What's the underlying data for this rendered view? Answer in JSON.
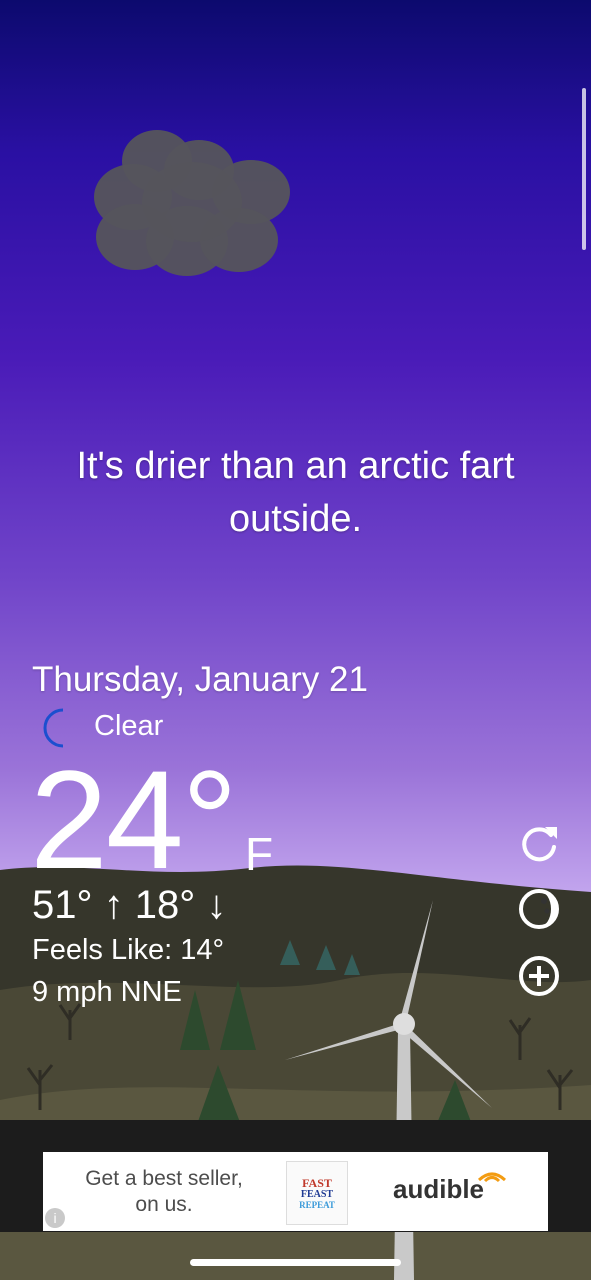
{
  "quote": "It's drier than an arctic fart outside.",
  "weather": {
    "date": "Thursday, January 21",
    "condition_icon": "moon-icon",
    "condition": "Clear",
    "temperature": "24°",
    "unit": "F",
    "hi_lo": "51° ↑  18° ↓",
    "feels_like": "Feels Like: 14°",
    "wind": "9 mph NNE"
  },
  "controls": {
    "refresh_icon": "refresh-icon",
    "theme_icon": "moon-phase-icon",
    "add_icon": "add-circle-icon"
  },
  "ad": {
    "text": "Get a best seller, on us.",
    "book_lines": [
      "FAST",
      "FEAST",
      "REPEAT"
    ],
    "brand": "audible",
    "info_icon": "info-icon"
  },
  "colors": {
    "sky_top": "#0c0a6e",
    "sky_bottom": "#cdb2f2",
    "ground": "#3a3a2f",
    "cloud": "#55545c"
  }
}
